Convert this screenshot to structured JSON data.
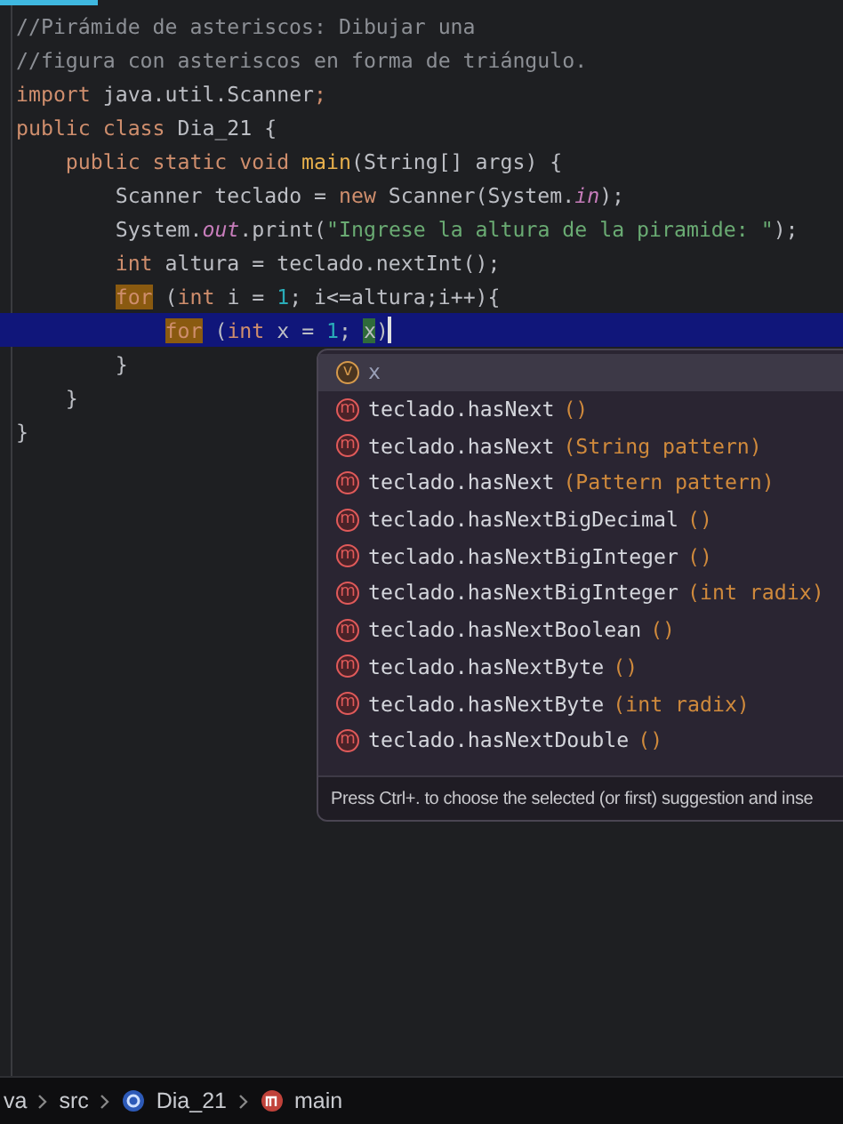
{
  "code_lines": [
    {
      "current": false,
      "tokens": [
        {
          "text": "//Pirámide de asteriscos: Dibujar una",
          "kind": "comment"
        }
      ]
    },
    {
      "current": false,
      "tokens": [
        {
          "text": "//figura con asteriscos en forma de triángulo.",
          "kind": "comment"
        }
      ]
    },
    {
      "current": false,
      "tokens": [
        {
          "text": "import ",
          "kind": "keyword"
        },
        {
          "text": "java.util.Scanner",
          "kind": "plain"
        },
        {
          "text": ";",
          "kind": "keyword"
        }
      ]
    },
    {
      "current": false,
      "tokens": [
        {
          "text": "public class ",
          "kind": "keyword"
        },
        {
          "text": "Dia_21 {",
          "kind": "plain"
        }
      ]
    },
    {
      "current": false,
      "tokens": [
        {
          "text": "    public static void ",
          "kind": "keyword"
        },
        {
          "text": "main",
          "kind": "method"
        },
        {
          "text": "(String[] args) {",
          "kind": "plain"
        }
      ]
    },
    {
      "current": false,
      "tokens": [
        {
          "text": "        Scanner teclado = ",
          "kind": "plain"
        },
        {
          "text": "new ",
          "kind": "keyword"
        },
        {
          "text": "Scanner(System.",
          "kind": "plain"
        },
        {
          "text": "in",
          "kind": "static"
        },
        {
          "text": ");",
          "kind": "plain"
        }
      ]
    },
    {
      "current": false,
      "tokens": [
        {
          "text": "        System.",
          "kind": "plain"
        },
        {
          "text": "out",
          "kind": "static"
        },
        {
          "text": ".print(",
          "kind": "plain"
        },
        {
          "text": "\"Ingrese la altura de la piramide: \"",
          "kind": "string"
        },
        {
          "text": ");",
          "kind": "plain"
        }
      ]
    },
    {
      "current": false,
      "tokens": [
        {
          "text": "        int ",
          "kind": "keyword"
        },
        {
          "text": "altura = teclado.nextInt();",
          "kind": "plain"
        }
      ]
    },
    {
      "current": false,
      "tokens": [
        {
          "text": "        for",
          "kind": "keyword",
          "marked": true
        },
        {
          "text": " (",
          "kind": "plain"
        },
        {
          "text": "int ",
          "kind": "keyword"
        },
        {
          "text": "i = ",
          "kind": "plain"
        },
        {
          "text": "1",
          "kind": "number"
        },
        {
          "text": "; i<=altura;i++){",
          "kind": "plain"
        }
      ]
    },
    {
      "current": true,
      "tokens": [
        {
          "text": "            for",
          "kind": "keyword",
          "marked": true
        },
        {
          "text": " (",
          "kind": "plain"
        },
        {
          "text": "int ",
          "kind": "keyword"
        },
        {
          "text": "x = ",
          "kind": "plain"
        },
        {
          "text": "1",
          "kind": "number"
        },
        {
          "text": "; ",
          "kind": "plain"
        },
        {
          "text": "x",
          "kind": "plain",
          "marked": true
        },
        {
          "text": ")",
          "kind": "plain"
        }
      ]
    },
    {
      "current": false,
      "tokens": [
        {
          "text": "        }",
          "kind": "plain"
        }
      ]
    },
    {
      "current": false,
      "tokens": [
        {
          "text": "    }",
          "kind": "plain"
        }
      ]
    },
    {
      "current": false,
      "tokens": [
        {
          "text": "}",
          "kind": "plain"
        }
      ]
    }
  ],
  "completion": {
    "items": [
      {
        "badge": "v",
        "kind": "variable",
        "name": "x",
        "selected": true
      },
      {
        "badge": "m",
        "kind": "method",
        "name": "teclado.hasNext",
        "params": "()",
        "selected": false
      },
      {
        "badge": "m",
        "kind": "method",
        "name": "teclado.hasNext",
        "params": "(String pattern)",
        "selected": false
      },
      {
        "badge": "m",
        "kind": "method",
        "name": "teclado.hasNext",
        "params": "(Pattern pattern)",
        "selected": false
      },
      {
        "badge": "m",
        "kind": "method",
        "name": "teclado.hasNextBigDecimal",
        "params": "()",
        "selected": false
      },
      {
        "badge": "m",
        "kind": "method",
        "name": "teclado.hasNextBigInteger",
        "params": "()",
        "selected": false
      },
      {
        "badge": "m",
        "kind": "method",
        "name": "teclado.hasNextBigInteger",
        "params": "(int radix)",
        "selected": false
      },
      {
        "badge": "m",
        "kind": "method",
        "name": "teclado.hasNextBoolean",
        "params": "()",
        "selected": false
      },
      {
        "badge": "m",
        "kind": "method",
        "name": "teclado.hasNextByte",
        "params": "()",
        "selected": false
      },
      {
        "badge": "m",
        "kind": "method",
        "name": "teclado.hasNextByte",
        "params": "(int radix)",
        "selected": false
      },
      {
        "badge": "m",
        "kind": "method",
        "name": "teclado.hasNextDouble",
        "params": "()",
        "selected": false
      }
    ],
    "hint": "Press Ctrl+. to choose the selected (or first) suggestion and inse"
  },
  "breadcrumbs": [
    {
      "text": "va",
      "kind": "folder"
    },
    {
      "text": "src",
      "kind": "folder"
    },
    {
      "text": "Dia_21",
      "kind": "class"
    },
    {
      "text": "main",
      "kind": "method"
    }
  ]
}
